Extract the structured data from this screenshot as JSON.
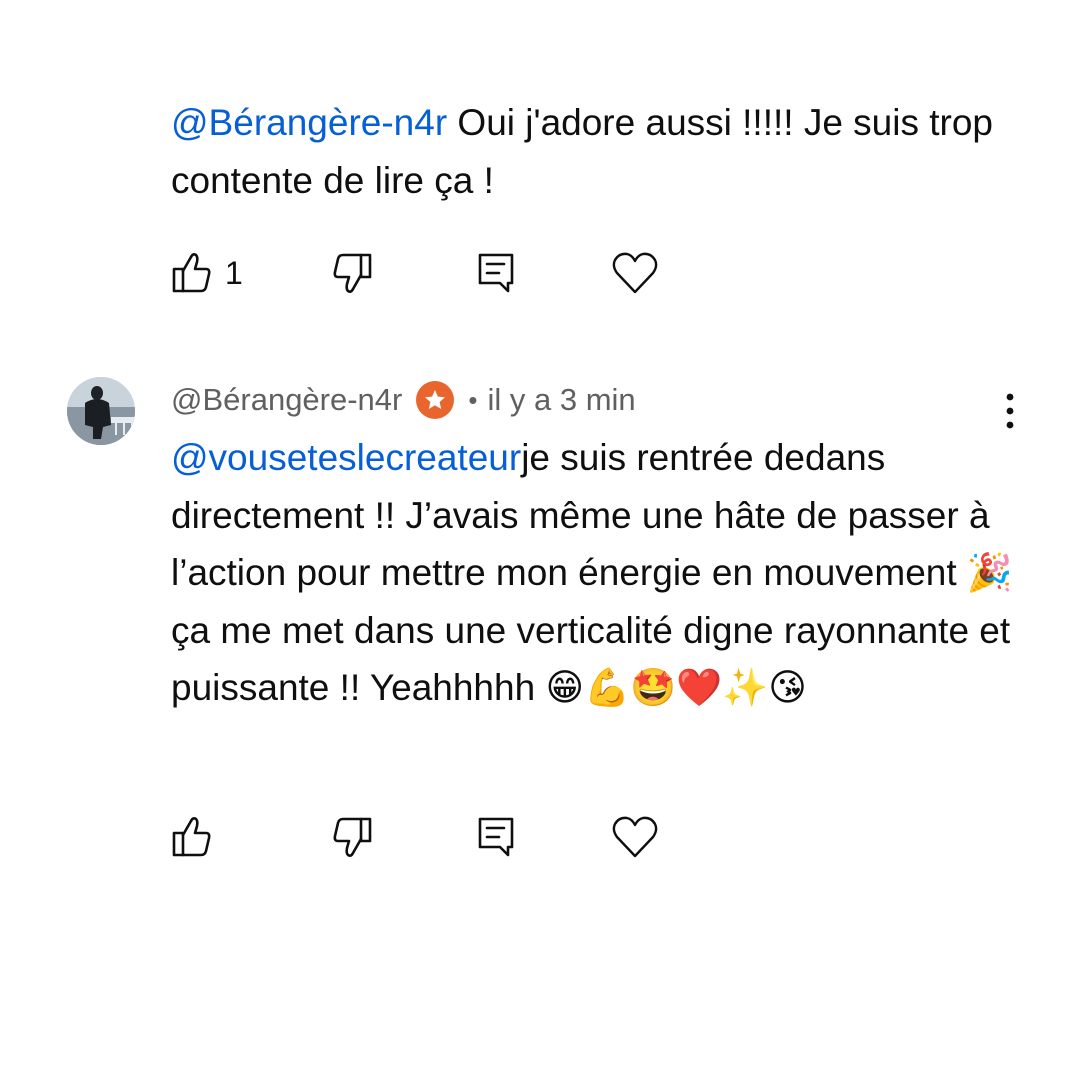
{
  "comment1": {
    "mention": "@Bérangère-n4r",
    "text": " Oui j'adore aussi !!!!! Je suis trop contente de lire ça !",
    "like_count": "1"
  },
  "comment2": {
    "author": "@Bérangère-n4r",
    "separator": "•",
    "timestamp": "il y a 3 min",
    "mention": "@vouseteslecreateur",
    "text_part1": "je suis rentrée dedans directement !! J’avais même une hâte de passer à l’action pour mettre mon énergie en mouvement ",
    "emoji_party": "🎉",
    "text_part2": " ça me met dans une verticalité digne rayonnante et puissante !! Yeahhhhh ",
    "emojis_end": "😁💪🤩❤️✨😘",
    "like_count": ""
  },
  "icons": {
    "like": "thumbs-up-icon",
    "dislike": "thumbs-down-icon",
    "reply": "reply-comment-icon",
    "heart": "heart-icon",
    "badge": "creator-star-badge-icon",
    "more": "more-vertical-icon"
  },
  "colors": {
    "mention": "#065fd4",
    "text": "#0f0f0f",
    "meta": "#606060",
    "badge": "#e8662e"
  }
}
